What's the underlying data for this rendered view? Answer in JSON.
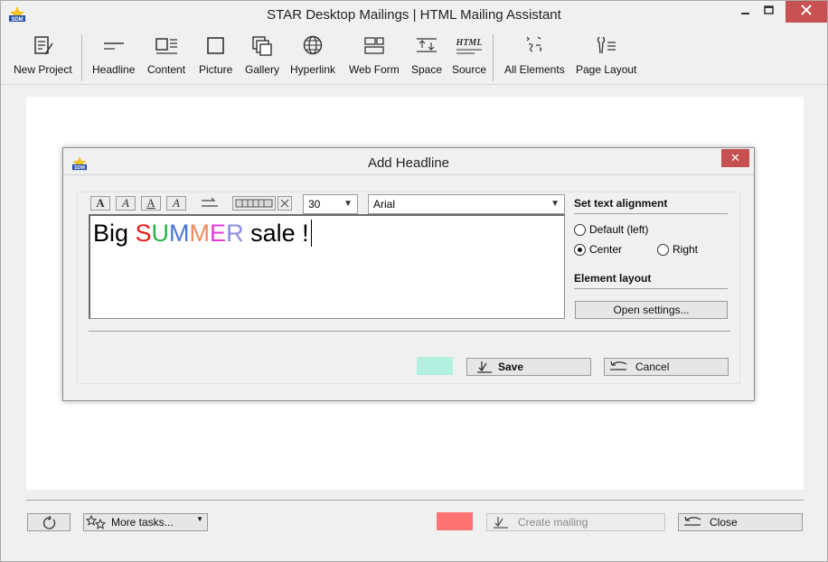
{
  "window": {
    "title": "STAR Desktop Mailings | HTML Mailing Assistant"
  },
  "toolbar": {
    "items": [
      {
        "label": "New Project",
        "icon": "new-project-icon"
      },
      {
        "label": "Headline",
        "icon": "headline-icon"
      },
      {
        "label": "Content",
        "icon": "content-icon"
      },
      {
        "label": "Picture",
        "icon": "picture-icon"
      },
      {
        "label": "Gallery",
        "icon": "gallery-icon"
      },
      {
        "label": "Hyperlink",
        "icon": "globe-icon"
      },
      {
        "label": "Web Form",
        "icon": "web-form-icon"
      },
      {
        "label": "Space",
        "icon": "space-icon"
      },
      {
        "label": "Source",
        "icon": "html-source-icon",
        "icon_text": "HTML"
      },
      {
        "label": "All Elements",
        "icon": "all-elements-icon"
      },
      {
        "label": "Page Layout",
        "icon": "page-layout-icon"
      }
    ]
  },
  "dialog": {
    "title": "Add Headline",
    "close_glyph": "✕",
    "format_buttons": [
      "A",
      "A",
      "A",
      "A"
    ],
    "font_size": "30",
    "font_family": "Arial",
    "headline": {
      "words_before": "Big ",
      "letters": [
        {
          "char": "S",
          "color": "#e8201f"
        },
        {
          "char": "U",
          "color": "#22b44a"
        },
        {
          "char": "M",
          "color": "#4a74d8"
        },
        {
          "char": "M",
          "color": "#f08a5d"
        },
        {
          "char": "E",
          "color": "#e23ad8"
        },
        {
          "char": "R",
          "color": "#8c8ce6"
        }
      ],
      "words_after": " sale !"
    },
    "alignment": {
      "heading": "Set text alignment",
      "options": [
        {
          "label": "Default (left)",
          "checked": false
        },
        {
          "label": "Center",
          "checked": true
        },
        {
          "label": "Right",
          "checked": false
        }
      ]
    },
    "layout": {
      "heading": "Element layout",
      "settings_button": "Open settings..."
    },
    "background_color": "#b3f0e0",
    "save_label": "Save",
    "cancel_label": "Cancel"
  },
  "footer": {
    "more_tasks_label": "More tasks...",
    "status_color": "#ff7373",
    "create_mailing_label": "Create mailing",
    "close_label": "Close"
  }
}
